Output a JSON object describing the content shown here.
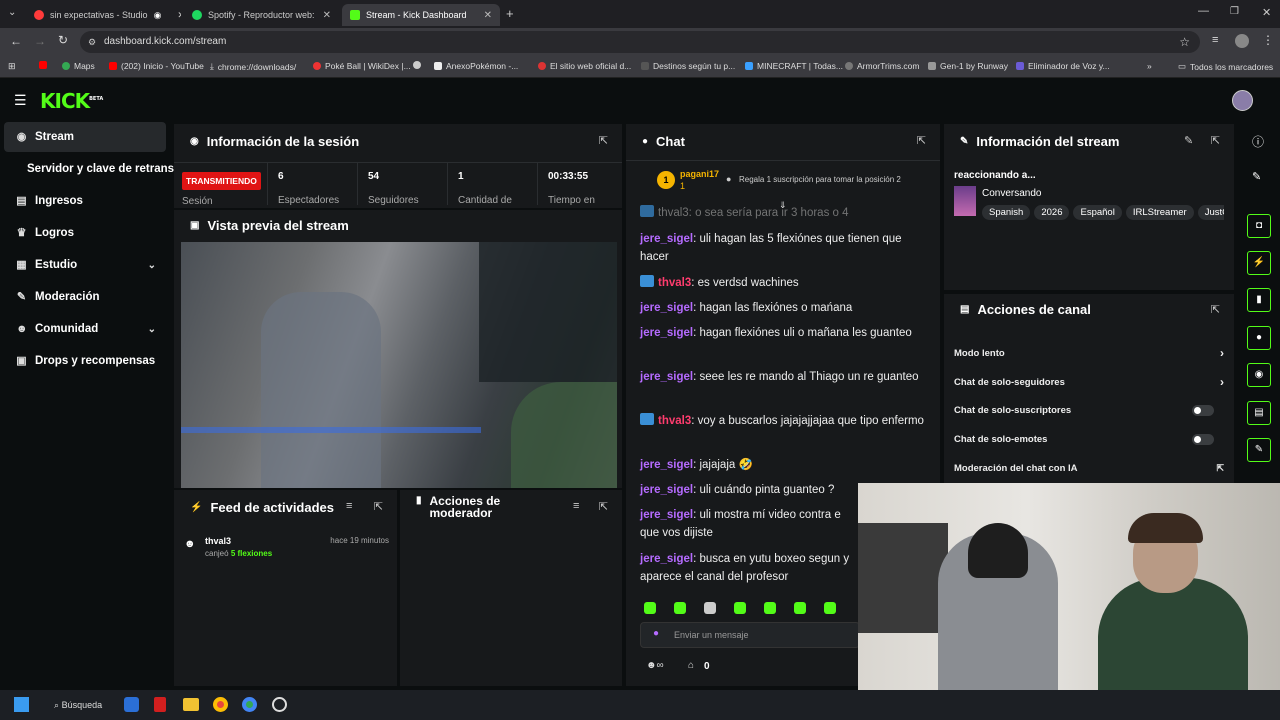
{
  "browser": {
    "tabs": [
      {
        "title": "sin expectativas - Studio",
        "color": "#ff3b3b"
      },
      {
        "title": "Spotify - Reproductor web: mús",
        "color": "#1ed760"
      },
      {
        "title": "Stream - Kick Dashboard",
        "color": "#53fc18"
      }
    ],
    "url": "dashboard.kick.com/stream",
    "bookmarks": [
      "Maps",
      "(202) Inicio - YouTube",
      "chrome://downloads/",
      "Poké Ball | WikiDex |...",
      "AnexoPokémon -...",
      "El sitio web oficial d...",
      "Destinos según tu p...",
      "MINECRAFT | Todas...",
      "ArmorTrims.com",
      "Gen-1 by Runway",
      "Eliminador de Voz y...",
      "Todos los marcadores"
    ]
  },
  "kick": {
    "logo": "KICK",
    "logo_sup": "BETA"
  },
  "sidebar": {
    "items": [
      {
        "label": "Stream",
        "icon": "broadcast-icon"
      },
      {
        "label": "Servidor y clave de retransm",
        "icon": ""
      },
      {
        "label": "Ingresos",
        "icon": "chart-icon"
      },
      {
        "label": "Logros",
        "icon": "trophy-icon"
      },
      {
        "label": "Estudio",
        "icon": "grid-icon"
      },
      {
        "label": "Moderación",
        "icon": "wrench-icon"
      },
      {
        "label": "Comunidad",
        "icon": "users-icon"
      },
      {
        "label": "Drops y recompensas",
        "icon": "gift-icon"
      }
    ]
  },
  "session": {
    "title": "Información de la sesión",
    "live_badge": "TRANSMITIENDO",
    "session_label": "Sesión",
    "stats": [
      {
        "value": "6",
        "label": "Espectadores"
      },
      {
        "value": "54",
        "label": "Seguidores"
      },
      {
        "value": "1",
        "label": "Cantidad de"
      },
      {
        "value": "00:33:55",
        "label": "Tiempo en"
      }
    ]
  },
  "preview": {
    "title": "Vista previa del stream"
  },
  "feed": {
    "title": "Feed de actividades",
    "item": {
      "user": "thval3",
      "action": "canjeó",
      "reward": "5 flexiones",
      "time": "hace 19 minutos"
    }
  },
  "modactions": {
    "title": "Acciones de moderador"
  },
  "chat": {
    "title": "Chat",
    "pinned_user": "pagani17",
    "pinned_rank": "1",
    "pinned_count": "1",
    "gift_text": "Regala 1 suscripción para tomar la posición 2",
    "top_partial": "thval3: o sea sería para ir 3 horas o 4",
    "messages": [
      {
        "user": "jere_sigel",
        "text": ": uli hagan las 5 flexiónes que tienen que hacer"
      },
      {
        "user": "thval3",
        "text": ": es verdsd wachines"
      },
      {
        "user": "jere_sigel",
        "text": ": hagan las flexiónes o mańana"
      },
      {
        "user": "jere_sigel",
        "text": ": hagan flexiónes uli o mañana les guanteo"
      },
      {
        "user": "jere_sigel",
        "text": ": seee les re mando al Thiago un re guanteo"
      },
      {
        "user": "thval3",
        "text": ": voy a buscarlos jajajajjajaa que tipo enfermo"
      },
      {
        "user": "jere_sigel",
        "text": ": jajajaja 🤣"
      },
      {
        "user": "jere_sigel",
        "text": ": uli cuándo pinta guanteo ?"
      },
      {
        "user": "jere_sigel",
        "text": ": uli mostra mí video contra e que vos dijiste"
      },
      {
        "user": "jere_sigel",
        "text": ": busca en yutu boxeo segun y aparece el canal del profesor"
      }
    ],
    "input_placeholder": "Enviar un mensaje",
    "points": "0"
  },
  "streaminfo": {
    "title": "Información del stream",
    "stream_title": "reaccionando a...",
    "category": "Conversando",
    "tags": [
      "Spanish",
      "2026",
      "Español",
      "IRLStreamer",
      "JustC"
    ]
  },
  "channel": {
    "title": "Acciones de canal",
    "rows": [
      {
        "label": "Modo lento",
        "kind": "arrow"
      },
      {
        "label": "Chat de solo-seguidores",
        "kind": "arrow"
      },
      {
        "label": "Chat de solo-suscriptores",
        "kind": "toggle"
      },
      {
        "label": "Chat de solo-emotes",
        "kind": "toggle"
      },
      {
        "label": "Moderación del chat con IA",
        "kind": "link"
      }
    ]
  },
  "taskbar": {
    "search": "Búsqueda"
  },
  "colors": {
    "accent": "#53fc18",
    "live": "#e01414",
    "user1": "#b56bff",
    "user2": "#ff3c6e"
  }
}
